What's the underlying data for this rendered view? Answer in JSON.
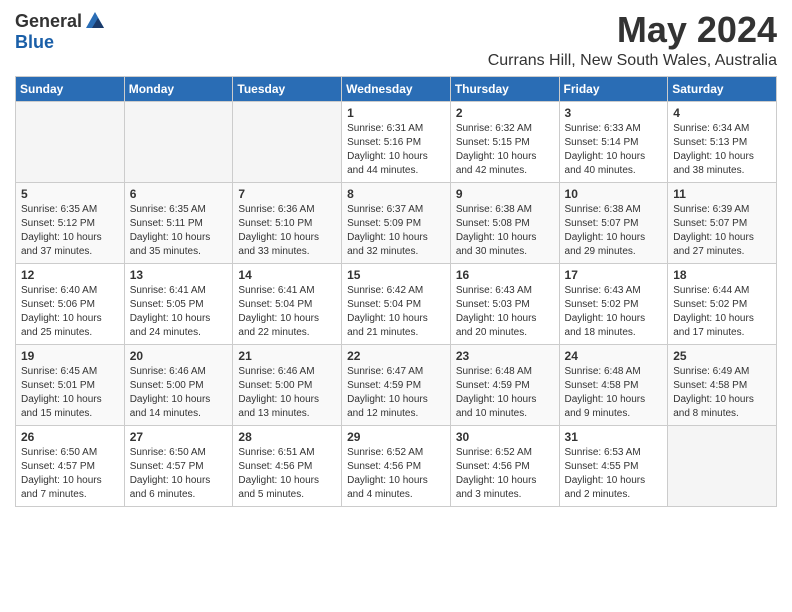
{
  "app": {
    "logo_general": "General",
    "logo_blue": "Blue",
    "title": "May 2024",
    "subtitle": "Currans Hill, New South Wales, Australia"
  },
  "calendar": {
    "headers": [
      "Sunday",
      "Monday",
      "Tuesday",
      "Wednesday",
      "Thursday",
      "Friday",
      "Saturday"
    ],
    "rows": [
      [
        {
          "num": "",
          "info": ""
        },
        {
          "num": "",
          "info": ""
        },
        {
          "num": "",
          "info": ""
        },
        {
          "num": "1",
          "info": "Sunrise: 6:31 AM\nSunset: 5:16 PM\nDaylight: 10 hours\nand 44 minutes."
        },
        {
          "num": "2",
          "info": "Sunrise: 6:32 AM\nSunset: 5:15 PM\nDaylight: 10 hours\nand 42 minutes."
        },
        {
          "num": "3",
          "info": "Sunrise: 6:33 AM\nSunset: 5:14 PM\nDaylight: 10 hours\nand 40 minutes."
        },
        {
          "num": "4",
          "info": "Sunrise: 6:34 AM\nSunset: 5:13 PM\nDaylight: 10 hours\nand 38 minutes."
        }
      ],
      [
        {
          "num": "5",
          "info": "Sunrise: 6:35 AM\nSunset: 5:12 PM\nDaylight: 10 hours\nand 37 minutes."
        },
        {
          "num": "6",
          "info": "Sunrise: 6:35 AM\nSunset: 5:11 PM\nDaylight: 10 hours\nand 35 minutes."
        },
        {
          "num": "7",
          "info": "Sunrise: 6:36 AM\nSunset: 5:10 PM\nDaylight: 10 hours\nand 33 minutes."
        },
        {
          "num": "8",
          "info": "Sunrise: 6:37 AM\nSunset: 5:09 PM\nDaylight: 10 hours\nand 32 minutes."
        },
        {
          "num": "9",
          "info": "Sunrise: 6:38 AM\nSunset: 5:08 PM\nDaylight: 10 hours\nand 30 minutes."
        },
        {
          "num": "10",
          "info": "Sunrise: 6:38 AM\nSunset: 5:07 PM\nDaylight: 10 hours\nand 29 minutes."
        },
        {
          "num": "11",
          "info": "Sunrise: 6:39 AM\nSunset: 5:07 PM\nDaylight: 10 hours\nand 27 minutes."
        }
      ],
      [
        {
          "num": "12",
          "info": "Sunrise: 6:40 AM\nSunset: 5:06 PM\nDaylight: 10 hours\nand 25 minutes."
        },
        {
          "num": "13",
          "info": "Sunrise: 6:41 AM\nSunset: 5:05 PM\nDaylight: 10 hours\nand 24 minutes."
        },
        {
          "num": "14",
          "info": "Sunrise: 6:41 AM\nSunset: 5:04 PM\nDaylight: 10 hours\nand 22 minutes."
        },
        {
          "num": "15",
          "info": "Sunrise: 6:42 AM\nSunset: 5:04 PM\nDaylight: 10 hours\nand 21 minutes."
        },
        {
          "num": "16",
          "info": "Sunrise: 6:43 AM\nSunset: 5:03 PM\nDaylight: 10 hours\nand 20 minutes."
        },
        {
          "num": "17",
          "info": "Sunrise: 6:43 AM\nSunset: 5:02 PM\nDaylight: 10 hours\nand 18 minutes."
        },
        {
          "num": "18",
          "info": "Sunrise: 6:44 AM\nSunset: 5:02 PM\nDaylight: 10 hours\nand 17 minutes."
        }
      ],
      [
        {
          "num": "19",
          "info": "Sunrise: 6:45 AM\nSunset: 5:01 PM\nDaylight: 10 hours\nand 15 minutes."
        },
        {
          "num": "20",
          "info": "Sunrise: 6:46 AM\nSunset: 5:00 PM\nDaylight: 10 hours\nand 14 minutes."
        },
        {
          "num": "21",
          "info": "Sunrise: 6:46 AM\nSunset: 5:00 PM\nDaylight: 10 hours\nand 13 minutes."
        },
        {
          "num": "22",
          "info": "Sunrise: 6:47 AM\nSunset: 4:59 PM\nDaylight: 10 hours\nand 12 minutes."
        },
        {
          "num": "23",
          "info": "Sunrise: 6:48 AM\nSunset: 4:59 PM\nDaylight: 10 hours\nand 10 minutes."
        },
        {
          "num": "24",
          "info": "Sunrise: 6:48 AM\nSunset: 4:58 PM\nDaylight: 10 hours\nand 9 minutes."
        },
        {
          "num": "25",
          "info": "Sunrise: 6:49 AM\nSunset: 4:58 PM\nDaylight: 10 hours\nand 8 minutes."
        }
      ],
      [
        {
          "num": "26",
          "info": "Sunrise: 6:50 AM\nSunset: 4:57 PM\nDaylight: 10 hours\nand 7 minutes."
        },
        {
          "num": "27",
          "info": "Sunrise: 6:50 AM\nSunset: 4:57 PM\nDaylight: 10 hours\nand 6 minutes."
        },
        {
          "num": "28",
          "info": "Sunrise: 6:51 AM\nSunset: 4:56 PM\nDaylight: 10 hours\nand 5 minutes."
        },
        {
          "num": "29",
          "info": "Sunrise: 6:52 AM\nSunset: 4:56 PM\nDaylight: 10 hours\nand 4 minutes."
        },
        {
          "num": "30",
          "info": "Sunrise: 6:52 AM\nSunset: 4:56 PM\nDaylight: 10 hours\nand 3 minutes."
        },
        {
          "num": "31",
          "info": "Sunrise: 6:53 AM\nSunset: 4:55 PM\nDaylight: 10 hours\nand 2 minutes."
        },
        {
          "num": "",
          "info": ""
        }
      ]
    ]
  }
}
